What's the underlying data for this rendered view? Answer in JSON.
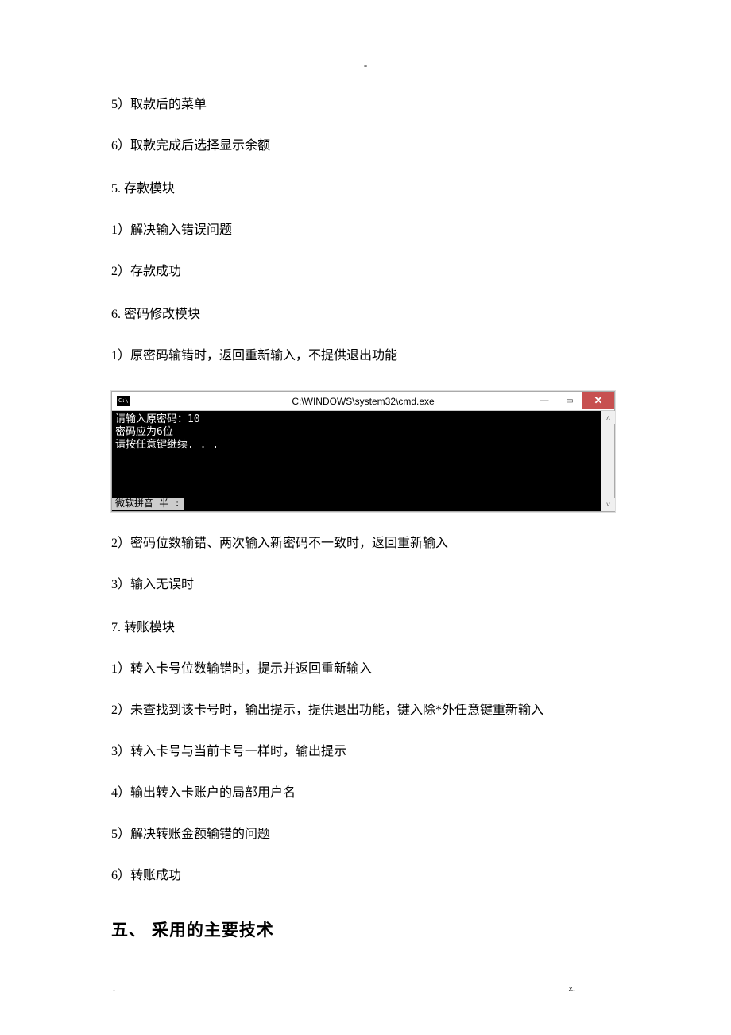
{
  "top_marker": "-",
  "items": {
    "i1": "5）取款后的菜单",
    "i2": "6）取款完成后选择显示余额",
    "s5": "5.   存款模块",
    "i3": "1）解决输入错误问题",
    "i4": "2）存款成功",
    "s6": "6.   密码修改模块",
    "i5": "1）原密码输错时，返回重新输入，不提供退出功能",
    "i6": "2）密码位数输错、两次输入新密码不一致时，返回重新输入",
    "i7": "3）输入无误时",
    "s7": "7.   转账模块",
    "i8": "1）转入卡号位数输错时，提示并返回重新输入",
    "i9": "2）未查找到该卡号时，输出提示，提供退出功能，键入除*外任意键重新输入",
    "i10": "3）转入卡号与当前卡号一样时，输出提示",
    "i11": "4）输出转入卡账户的局部用户名",
    "i12": "5）解决转账金额输错的问题",
    "i13": "6）转账成功"
  },
  "heading": "五、 采用的主要技术",
  "console": {
    "icon_text": "C:\\",
    "title": "C:\\WINDOWS\\system32\\cmd.exe",
    "line1": "请输入原密码：10",
    "line2": "密码应为6位",
    "line3": "请按任意键继续. . .",
    "ime": "微软拼音 半 :",
    "up_glyph": "˄",
    "down_glyph": "˅",
    "close_glyph": "✕",
    "min_glyph": "—",
    "max_glyph": "▭"
  },
  "footer": {
    "left": ".",
    "right": "z."
  }
}
